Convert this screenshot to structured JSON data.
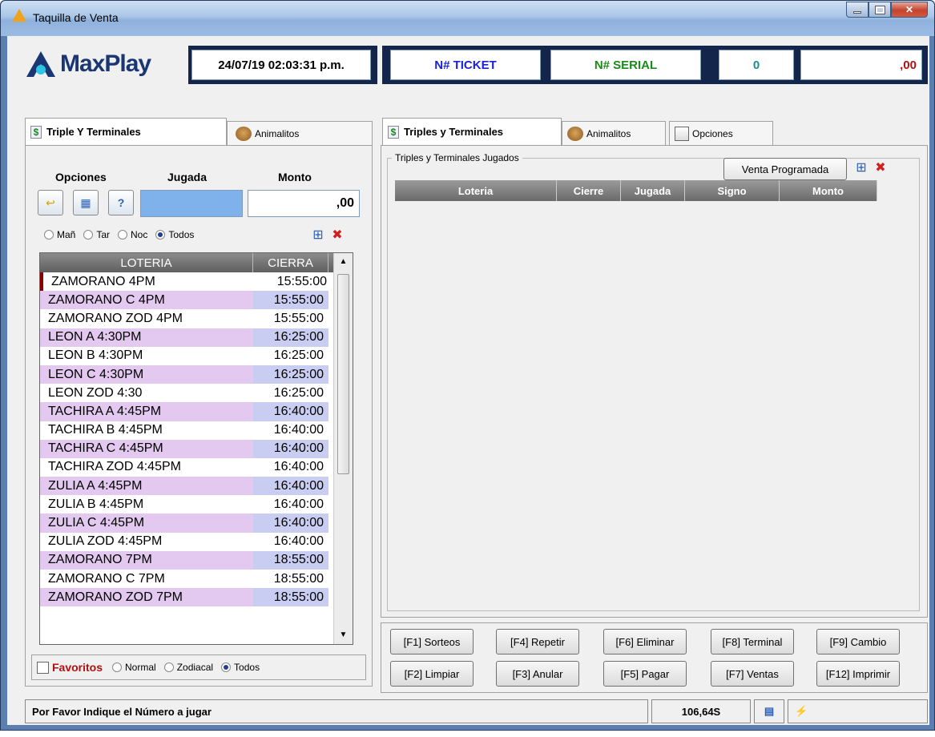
{
  "window": {
    "title": "Taquilla de Venta"
  },
  "header": {
    "logo_text": "MaxPlay",
    "datetime": "24/07/19 02:03:31 p.m.",
    "ticket_label": "N# TICKET",
    "serial_label": "N# SERIAL",
    "count": "0",
    "amount": ",00",
    "colors": {
      "ticket": "#1a22d8",
      "serial": "#1a8b1a",
      "count": "#1a8b9a",
      "amount": "#b01010"
    }
  },
  "left": {
    "tabs": [
      {
        "label": "Triple Y Terminales",
        "icon": "dollar-icon"
      },
      {
        "label": "Animalitos",
        "icon": "lion-icon"
      }
    ],
    "labels": {
      "opciones": "Opciones",
      "jugada": "Jugada",
      "monto": "Monto"
    },
    "monto_value": ",00",
    "shift_radios": [
      {
        "label": "Mañ",
        "selected": false
      },
      {
        "label": "Tar",
        "selected": false
      },
      {
        "label": "Noc",
        "selected": false
      },
      {
        "label": "Todos",
        "selected": true
      }
    ],
    "list": {
      "headers": [
        "LOTERIA",
        "CIERRA"
      ],
      "rows": [
        [
          "ZAMORANO 4PM",
          "15:55:00"
        ],
        [
          "ZAMORANO C 4PM",
          "15:55:00"
        ],
        [
          "ZAMORANO ZOD 4PM",
          "15:55:00"
        ],
        [
          "LEON A 4:30PM",
          "16:25:00"
        ],
        [
          "LEON B 4:30PM",
          "16:25:00"
        ],
        [
          "LEON C 4:30PM",
          "16:25:00"
        ],
        [
          "LEON ZOD 4:30",
          "16:25:00"
        ],
        [
          "TACHIRA A 4:45PM",
          "16:40:00"
        ],
        [
          "TACHIRA B 4:45PM",
          "16:40:00"
        ],
        [
          "TACHIRA C 4:45PM",
          "16:40:00"
        ],
        [
          "TACHIRA ZOD 4:45PM",
          "16:40:00"
        ],
        [
          "ZULIA A 4:45PM",
          "16:40:00"
        ],
        [
          "ZULIA B 4:45PM",
          "16:40:00"
        ],
        [
          "ZULIA C 4:45PM",
          "16:40:00"
        ],
        [
          "ZULIA ZOD 4:45PM",
          "16:40:00"
        ],
        [
          "ZAMORANO 7PM",
          "18:55:00"
        ],
        [
          "ZAMORANO C 7PM",
          "18:55:00"
        ],
        [
          "ZAMORANO ZOD 7PM",
          "18:55:00"
        ]
      ]
    },
    "favoritos_label": "Favoritos",
    "type_radios": [
      {
        "label": "Normal",
        "selected": false
      },
      {
        "label": "Zodiacal",
        "selected": false
      },
      {
        "label": "Todos",
        "selected": true
      }
    ]
  },
  "right": {
    "tabs": [
      {
        "label": "Triples y Terminales",
        "icon": "dollar-icon"
      },
      {
        "label": "Animalitos",
        "icon": "lion-icon"
      },
      {
        "label": "Opciones",
        "icon": "options-icon"
      }
    ],
    "group_label": "Triples y Terminales Jugados",
    "venta_programada": "Venta Programada",
    "grid_headers": [
      "Loteria",
      "Cierre",
      "Jugada",
      "Signo",
      "Monto"
    ],
    "fkeys": [
      [
        "[F1] Sorteos",
        "[F4] Repetir",
        "[F6] Eliminar",
        "[F8] Terminal",
        "[F9] Cambio"
      ],
      [
        "[F2] Limpiar",
        "[F3] Anular",
        "[F5] Pagar",
        "[F7] Ventas",
        "[F12]  Imprimir"
      ]
    ]
  },
  "status": {
    "message": "Por Favor Indique el Número a jugar",
    "balance": "106,64S"
  }
}
